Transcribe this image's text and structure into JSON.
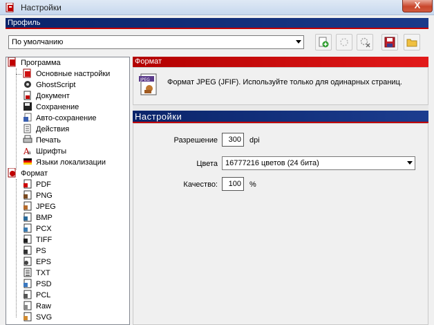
{
  "window": {
    "title": "Настройки",
    "close_label": "X"
  },
  "profile": {
    "band_label": "Профиль",
    "selected": "По умолчанию",
    "toolbar_icons": [
      "add-profile-icon",
      "rename-profile-icon",
      "delete-profile-icon",
      "save-profile-icon",
      "open-profile-icon"
    ]
  },
  "tree": {
    "program": {
      "label": "Программа",
      "children": [
        {
          "label": "Основные настройки",
          "icon": "settings-icon"
        },
        {
          "label": "GhostScript",
          "icon": "ghostscript-icon"
        },
        {
          "label": "Документ",
          "icon": "document-icon"
        },
        {
          "label": "Сохранение",
          "icon": "save-icon"
        },
        {
          "label": "Авто-сохранение",
          "icon": "autosave-icon"
        },
        {
          "label": "Действия",
          "icon": "actions-icon"
        },
        {
          "label": "Печать",
          "icon": "print-icon"
        },
        {
          "label": "Шрифты",
          "icon": "fonts-icon"
        },
        {
          "label": "Языки локализации",
          "icon": "language-flag-icon"
        }
      ]
    },
    "format": {
      "label": "Формат",
      "children": [
        {
          "label": "PDF",
          "icon": "pdf-file-icon"
        },
        {
          "label": "PNG",
          "icon": "png-file-icon"
        },
        {
          "label": "JPEG",
          "icon": "jpeg-file-icon"
        },
        {
          "label": "BMP",
          "icon": "bmp-file-icon"
        },
        {
          "label": "PCX",
          "icon": "pcx-file-icon"
        },
        {
          "label": "TIFF",
          "icon": "tiff-file-icon"
        },
        {
          "label": "PS",
          "icon": "ps-file-icon"
        },
        {
          "label": "EPS",
          "icon": "eps-file-icon"
        },
        {
          "label": "TXT",
          "icon": "txt-file-icon"
        },
        {
          "label": "PSD",
          "icon": "psd-file-icon"
        },
        {
          "label": "PCL",
          "icon": "pcl-file-icon"
        },
        {
          "label": "Raw",
          "icon": "raw-file-icon"
        },
        {
          "label": "SVG",
          "icon": "svg-file-icon"
        }
      ]
    }
  },
  "format_section": {
    "header": "Формат",
    "description": "Формат JPEG (JFIF). Используйте только для одинарных страниц."
  },
  "settings_section": {
    "header": "Настройки",
    "resolution": {
      "label": "Разрешение",
      "value": "300",
      "unit": "dpi"
    },
    "colors": {
      "label": "Цвета",
      "selected": "16777216 цветов (24 бита)"
    },
    "quality": {
      "label": "Качество:",
      "value": "100",
      "unit": "%"
    }
  },
  "colors": {
    "band_blue": "#0a246a",
    "band_red": "#c00000"
  }
}
